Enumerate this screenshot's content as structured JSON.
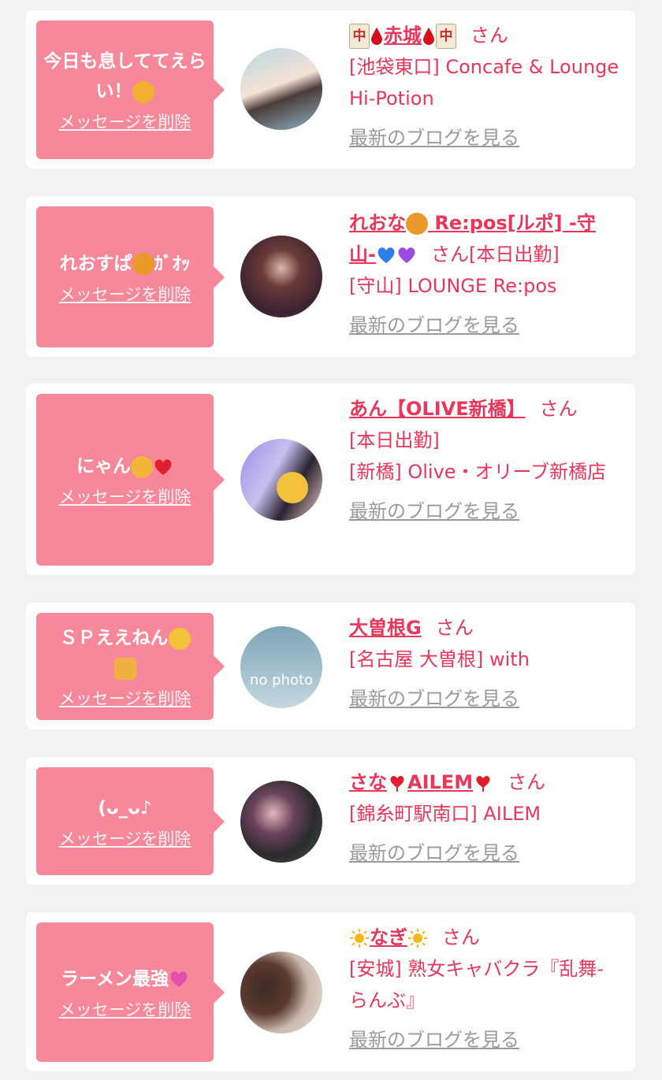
{
  "items": [
    {
      "message": "今日も息しててえらい！",
      "delete_label": "メッセージを削除",
      "name": "赤城",
      "san": "さん",
      "shop_lines": [
        "[池袋東口] Concafe & Lounge Hi-Potion"
      ],
      "blog_label": "最新のブログを見る"
    },
    {
      "message": "れおすぱ",
      "message_suffix": "ｶﾞｵｯ",
      "delete_label": "メッセージを削除",
      "name": "れおな",
      "name_rest": "Re:pos[ルポ] -守山-",
      "san": "さん",
      "status": "[本日出勤]",
      "shop_lines": [
        "[守山] LOUNGE Re:pos"
      ],
      "blog_label": "最新のブログを見る"
    },
    {
      "message": "にゃん",
      "delete_label": "メッセージを削除",
      "name": "あん【OLIVE新橋】",
      "san": "さん",
      "status": "[本日出勤]",
      "shop_lines": [
        "[新橋] Olive・オリーブ新橋店"
      ],
      "blog_label": "最新のブログを見る"
    },
    {
      "message": "ＳＰええねん",
      "delete_label": "メッセージを削除",
      "name": "大曽根G",
      "san": "さん",
      "shop_lines": [
        "[名古屋 大曽根] with"
      ],
      "blog_label": "最新のブログを見る",
      "avatar_text": "no photo"
    },
    {
      "message": "(ᴗ_ᴗ♪",
      "delete_label": "メッセージを削除",
      "name": "さな",
      "name_rest": "AILEM",
      "san": "さん",
      "shop_lines": [
        "[錦糸町駅南口] AILEM"
      ],
      "blog_label": "最新のブログを見る"
    },
    {
      "message": "ラーメン最強",
      "delete_label": "メッセージを削除",
      "name": "なぎ",
      "san": "さん",
      "shop_lines": [
        "[安城] 熟女キャバクラ『乱舞-らんぶ』"
      ],
      "blog_label": "最新のブログを見る"
    }
  ],
  "colors": {
    "accent": "#e8375a",
    "bubble": "#f7889a",
    "muted": "#9a9a9a",
    "background": "#f2f2f2"
  },
  "icons": [
    "mahjong-tile-icon",
    "blood-drop-icon",
    "lion-icon",
    "heart-icon",
    "cat-icon",
    "wink-face-icon",
    "thumbs-up-icon",
    "sun-icon",
    "kiss-cat-icon",
    "pink-heart-icon"
  ]
}
